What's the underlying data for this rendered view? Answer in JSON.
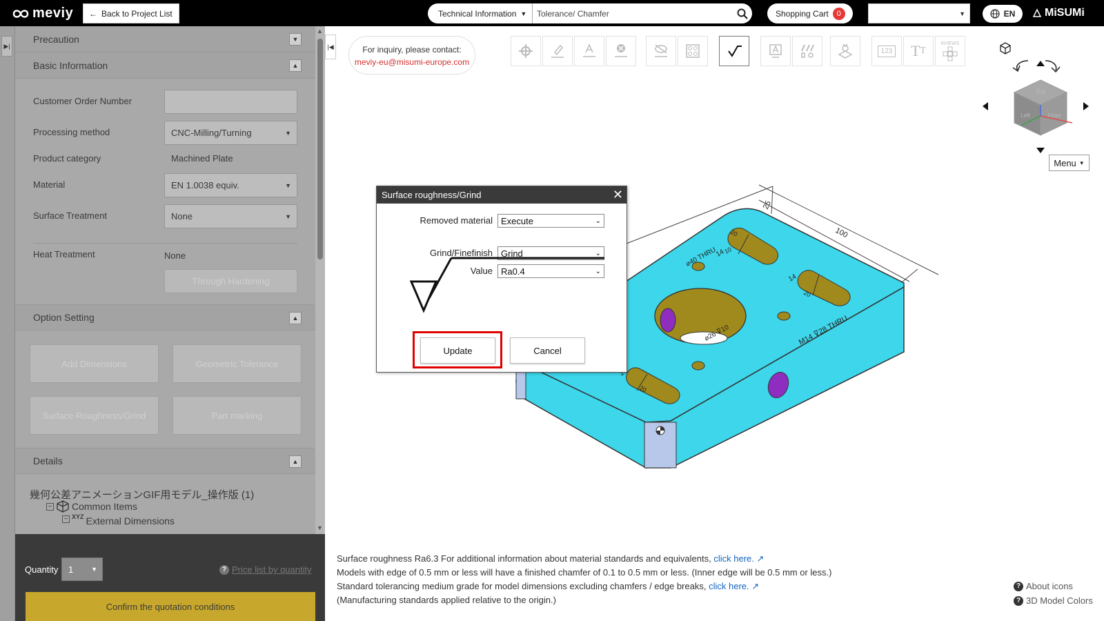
{
  "header": {
    "logo": "meviy",
    "back_label": "Back to Project List",
    "search_category": "Technical Information",
    "search_value": "Tolerance/ Chamfer",
    "cart_label": "Shopping Cart",
    "cart_count": "0",
    "language": "EN",
    "brand": "MiSUMi"
  },
  "sidebar": {
    "precaution": "Precaution",
    "basic_info": {
      "title": "Basic Information",
      "customer_order_label": "Customer Order Number",
      "customer_order_value": "",
      "processing_label": "Processing method",
      "processing_value": "CNC-Milling/Turning",
      "category_label": "Product category",
      "category_value": "Machined Plate",
      "material_label": "Material",
      "material_value": "EN 1.0038 equiv.",
      "surface_label": "Surface Treatment",
      "surface_value": "None",
      "heat_label": "Heat Treatment",
      "heat_value": "None",
      "hardening_button": "Through Hardening"
    },
    "option_setting": {
      "title": "Option Setting",
      "buttons": [
        "Add Dimensions",
        "Geometric Tolerance",
        "Surface Roughness/Grind",
        "Part marking"
      ]
    },
    "details": {
      "title": "Details",
      "tree_title": "幾何公差アニメーションGIF用モデル_操作版 (1)",
      "common_items": "Common Items",
      "external_dimensions": "External Dimensions",
      "xyz": "XYZ"
    },
    "quantity_label": "Quantity",
    "quantity_value": "1",
    "price_link": "Price list by quantity",
    "confirm_button": "Confirm the quotation conditions"
  },
  "inquiry": {
    "line1": "For inquiry, please contact:",
    "email": "meviy-eu@misumi-europe.com"
  },
  "viewer": {
    "menu_label": "Menu",
    "tool_badge_views": "6VIEWS",
    "tool_badge_123": "123",
    "cube_faces": [
      "Top",
      "Left",
      "Front"
    ],
    "dimensions": {
      "d25": "25",
      "d100": "100",
      "d14a": "14",
      "d14b": "14",
      "d14c": "14",
      "d20a": "20",
      "d20b": "20",
      "d20c": "20",
      "d10": "10",
      "hole_large": "⌀40 THRU",
      "hole_depth": "⌀26 ⊽10",
      "thread": "M14 ⊽28 THRU"
    }
  },
  "dialog": {
    "title": "Surface roughness/Grind",
    "removed_label": "Removed material",
    "removed_value": "Execute",
    "grind_label": "Grind/Finefinish",
    "grind_value": "Grind",
    "value_label": "Value",
    "value_value": "Ra0.4",
    "update_button": "Update",
    "cancel_button": "Cancel"
  },
  "info": {
    "line1_prefix": "Surface roughness Ra6.3    For additional information about material standards and equivalents,",
    "line1_link": "click here.",
    "line2": "Models with edge of 0.5 mm or less will have a finished chamfer of 0.1 to 0.5 mm or less. (Inner edge will be 0.5 mm or less.)",
    "line3_prefix": "Standard tolerancing medium grade for model dimensions excluding chamfers / edge breaks,",
    "line3_link": "click here.",
    "line4": "(Manufacturing standards applied relative to the origin.)",
    "about_icons": "About icons",
    "model_colors": "3D Model Colors"
  },
  "colors": {
    "part_body": "#3dd6ea",
    "slot_fill": "#a08a1e",
    "hole_purple": "#8e2dbf",
    "confirm_button": "#c8a82c",
    "highlight": "#e00000"
  }
}
